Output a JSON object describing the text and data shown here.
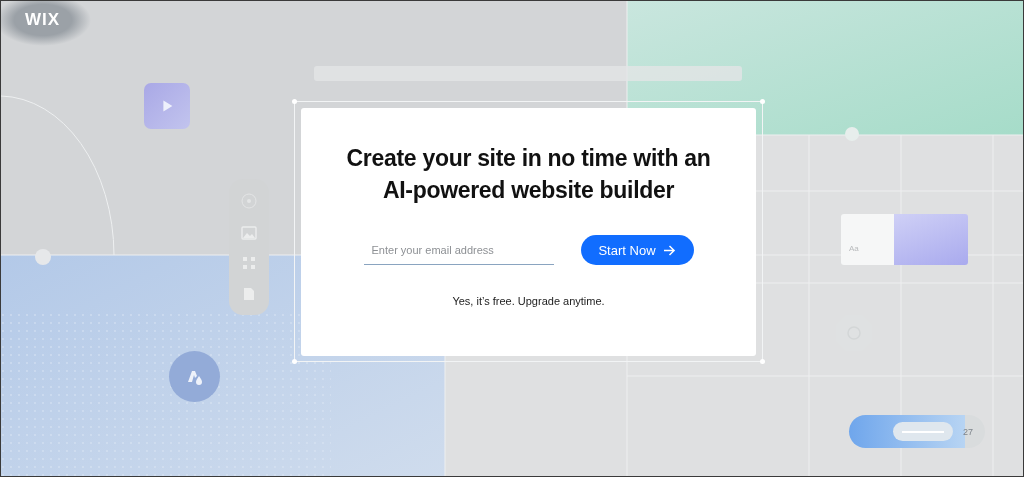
{
  "logo": "WIX",
  "hero": {
    "headline": "Create your site in no time with an AI-powered website builder",
    "email_field": {
      "placeholder": "Enter your email address"
    },
    "button": "Start Now",
    "note": "Yes, it’s free. Upgrade anytime."
  },
  "swatch_card": {
    "label": "Aa"
  },
  "slider_pill": {
    "value": "27"
  }
}
